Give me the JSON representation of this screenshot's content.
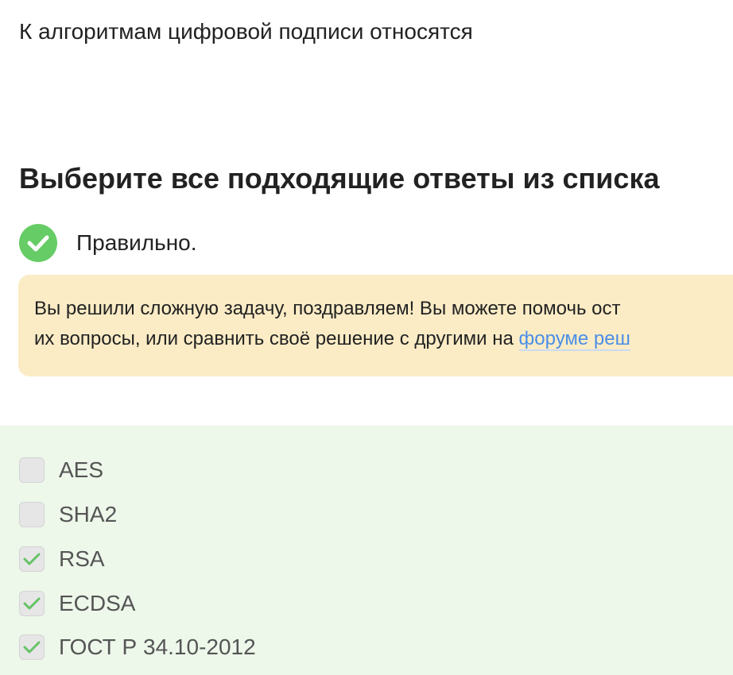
{
  "question": {
    "text": "К алгоритмам цифровой подписи относятся"
  },
  "instructions": {
    "text": "Выберите все подходящие ответы из списка"
  },
  "status": {
    "text": "Правильно.",
    "icon": "check-circle-icon",
    "color": "#66cc66"
  },
  "hint": {
    "line1": "Вы решили сложную задачу, поздравляем! Вы можете помочь ост",
    "line2_prefix": "их вопросы, или сравнить своё решение с другими на ",
    "link_text": "форуме реш",
    "background": "#fbecc6",
    "link_color": "#4b8ee6"
  },
  "options": {
    "background": "#edf7ea",
    "items": [
      {
        "label": "AES",
        "checked": false
      },
      {
        "label": "SHA2",
        "checked": false
      },
      {
        "label": "RSA",
        "checked": true
      },
      {
        "label": "ECDSA",
        "checked": true
      },
      {
        "label": "ГОСТ Р 34.10-2012",
        "checked": true
      }
    ]
  }
}
